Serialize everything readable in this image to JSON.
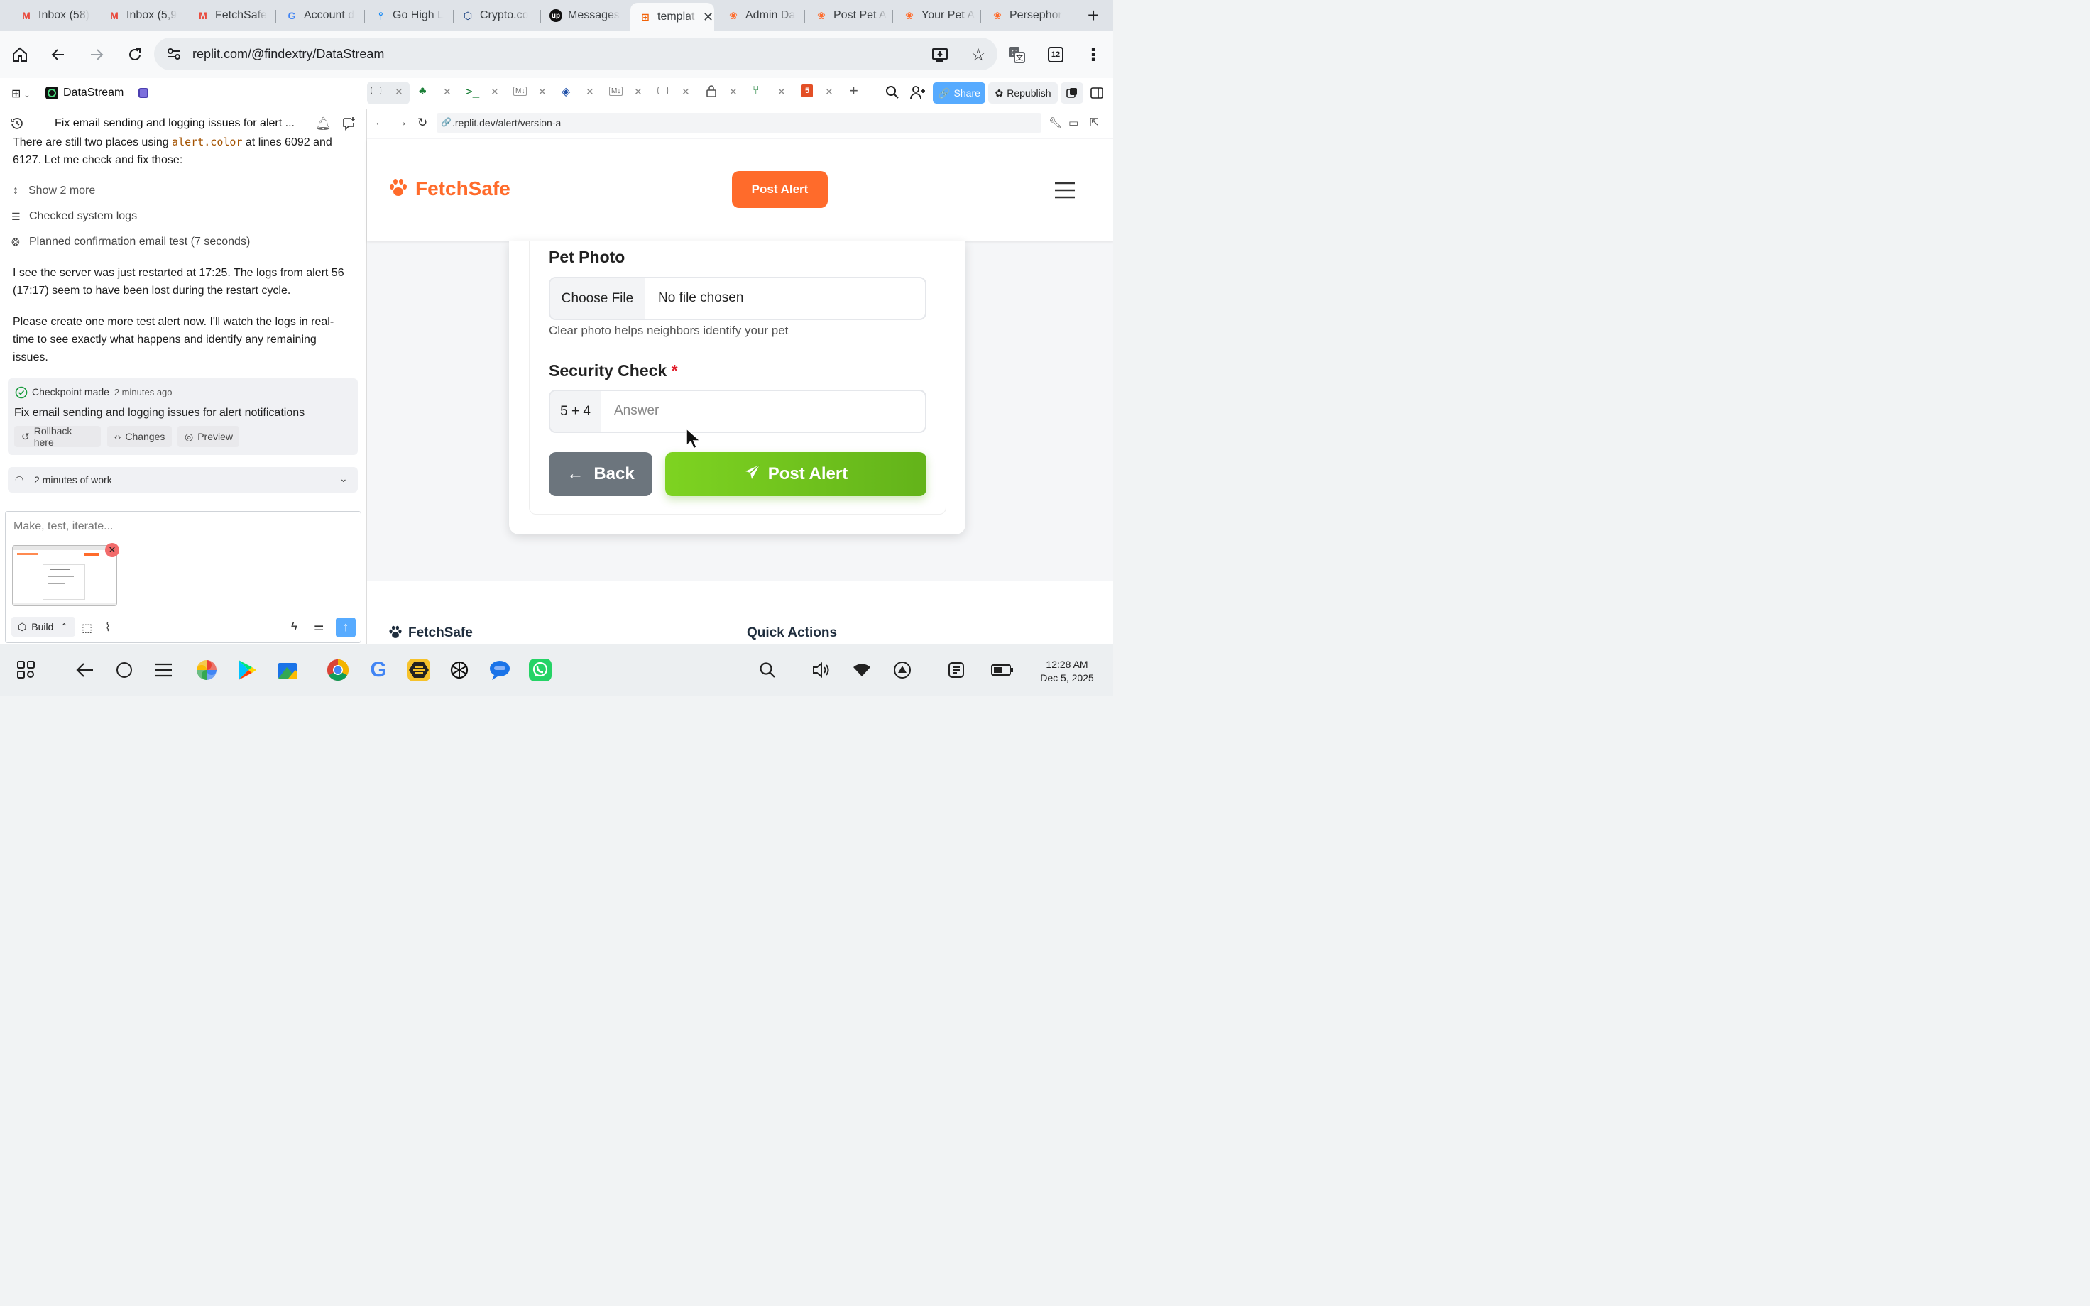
{
  "browser": {
    "tabs": [
      {
        "label": "Inbox (58)",
        "icon": "gmail-icon"
      },
      {
        "label": "Inbox (5,9",
        "icon": "gmail-icon"
      },
      {
        "label": "FetchSafe",
        "icon": "gmail-icon"
      },
      {
        "label": "Account d",
        "icon": "google-icon"
      },
      {
        "label": "Go High L",
        "icon": "gohighlevel-icon"
      },
      {
        "label": "Crypto.co",
        "icon": "crypto-icon"
      },
      {
        "label": "Messages",
        "icon": "upwork-icon"
      },
      {
        "label": "templat",
        "icon": "replit-icon"
      },
      {
        "label": "Admin Da",
        "icon": "paw-icon"
      },
      {
        "label": "Post Pet A",
        "icon": "paw-icon"
      },
      {
        "label": "Your Pet A",
        "icon": "paw-icon"
      },
      {
        "label": "Persephor",
        "icon": "paw-icon"
      }
    ],
    "url": "replit.com/@findextry/DataStream",
    "extension_badge": "12"
  },
  "replit": {
    "project_name": "DataStream",
    "chat_title": "Fix email sending and logging issues for alert ...",
    "msg1_a": "There are still two places using ",
    "msg1_code": "alert.color",
    "msg1_b": " at lines 6092 and 6127. Let me check and fix those:",
    "show_more": "Show 2 more",
    "checked_logs": "Checked system logs",
    "planned_test": "Planned confirmation email test (7 seconds)",
    "msg2": "I see the server was just restarted at 17:25. The logs from alert 56 (17:17) seem to have been lost during the restart cycle.",
    "msg3": "Please create one more test alert now. I'll watch the logs in real-time to see exactly what happens and identify any remaining issues.",
    "checkpoint_label": "Checkpoint made",
    "checkpoint_time": "2 minutes ago",
    "checkpoint_desc": "Fix email sending and logging issues for alert notifications",
    "rollback": "Rollback here",
    "changes": "Changes",
    "preview": "Preview",
    "work_time": "2 minutes of work",
    "input_placeholder": "Make, test, iterate...",
    "build": "Build",
    "share": "Share",
    "republish": "Republish",
    "preview_url": ".replit.dev/alert/version-a"
  },
  "site": {
    "brand": "FetchSafe",
    "post_alert_header": "Post Alert",
    "pet_photo_label": "Pet Photo",
    "choose_file": "Choose File",
    "no_file": "No file chosen",
    "photo_hint": "Clear photo helps neighbors identify your pet",
    "security_label": "Security Check",
    "required_mark": "*",
    "captcha": "5 + 4",
    "answer_placeholder": "Answer",
    "back": "Back",
    "post_alert": "Post Alert",
    "footer_brand": "FetchSafe",
    "quick_actions": "Quick Actions"
  },
  "system": {
    "time": "12:28 AM",
    "date": "Dec 5, 2025"
  },
  "colors": {
    "orange": "#ff6b2b",
    "green": "#6fc21c",
    "gray_btn": "#6c757d"
  }
}
